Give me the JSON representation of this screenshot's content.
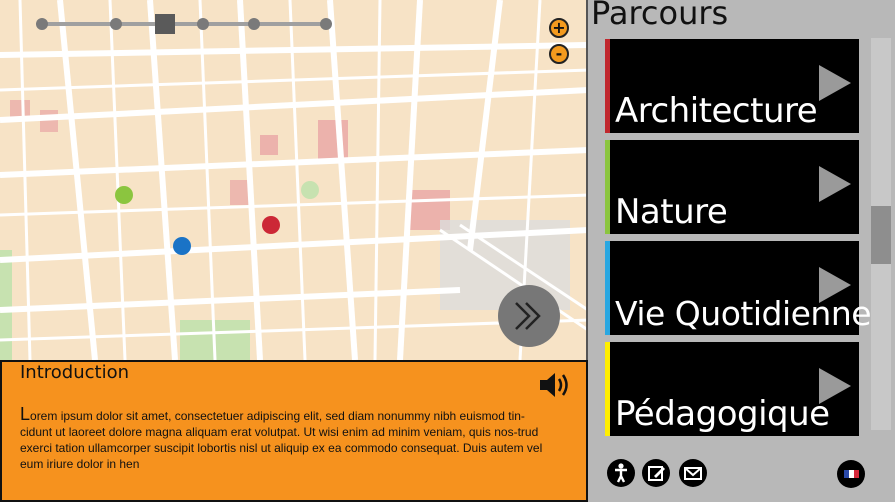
{
  "map": {
    "slider": {
      "steps": 7,
      "selected_step": 3
    },
    "zoom_in_label": "+",
    "zoom_out_label": "-",
    "pois": [
      {
        "color": "#8bc53f"
      },
      {
        "color": "#1a73c6"
      },
      {
        "color": "#cc2836"
      }
    ]
  },
  "intro": {
    "title": "Introduction",
    "body": "Lorem ipsum dolor sit amet, consectetuer adipiscing elit, sed diam nonummy nibh euismod tin-cidunt ut laoreet dolore magna aliquam erat volutpat. Ut wisi enim ad minim veniam, quis nos-trud exerci tation ullamcorper suscipit lobortis nisl ut aliquip ex ea commodo consequat. Duis autem vel eum iriure dolor in hen"
  },
  "panel": {
    "title": "Parcours",
    "routes": [
      {
        "label": "Architecture",
        "color": "#c0272d"
      },
      {
        "label": "Nature",
        "color": "#8bc53f"
      },
      {
        "label": "Vie Quotidienne",
        "color": "#29a7e1"
      },
      {
        "label": "Pédagogique",
        "color": "#ffee00"
      }
    ]
  },
  "footer": {
    "icons": [
      "accessibility-icon",
      "edit-icon",
      "mail-icon",
      "french-flag-icon"
    ]
  },
  "colors": {
    "accent": "#f6921e",
    "panel": "#b8b8b8"
  }
}
